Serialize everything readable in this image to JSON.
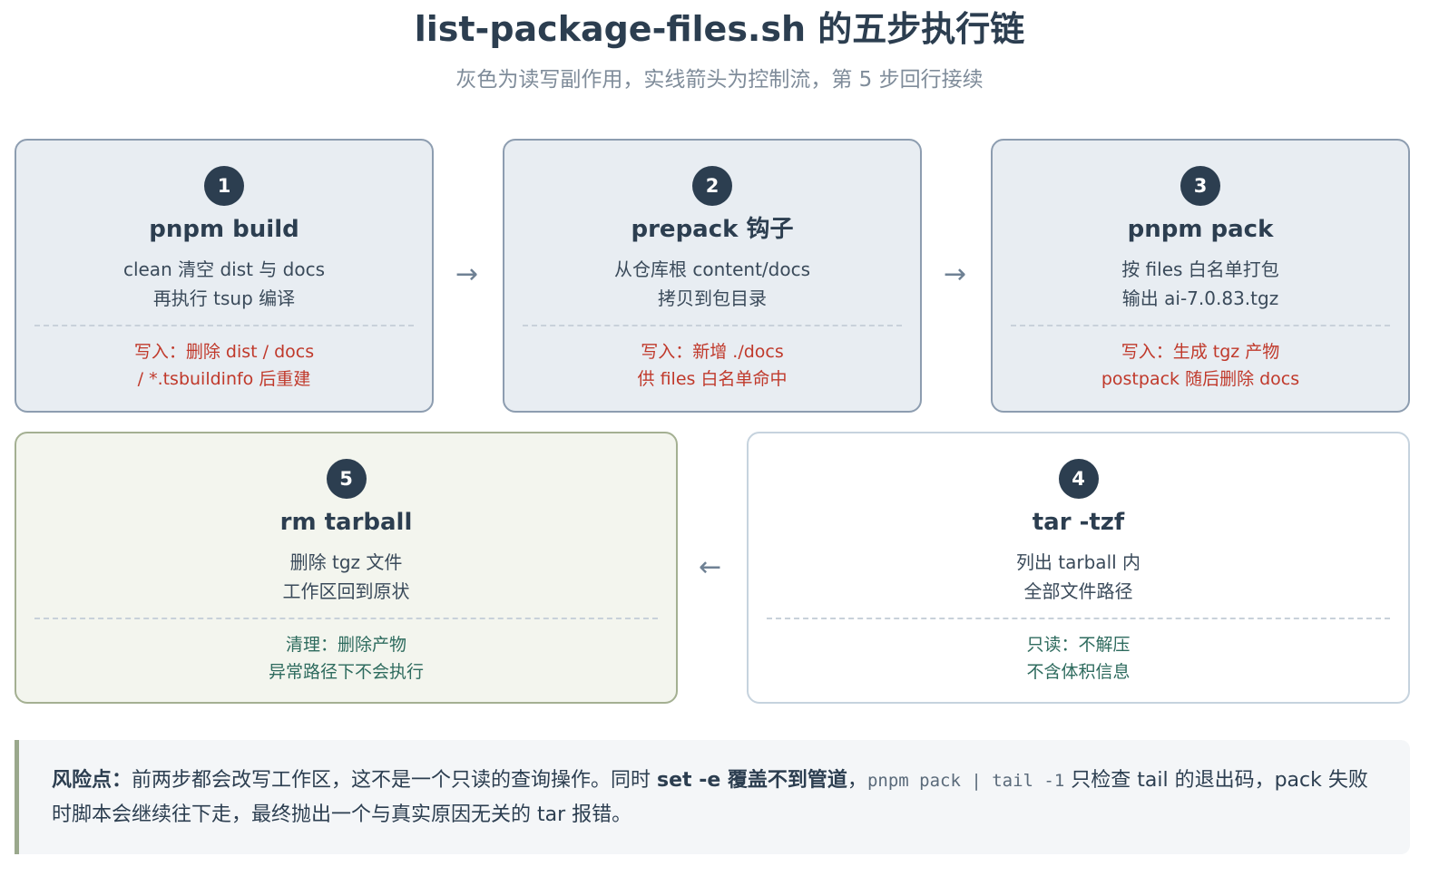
{
  "header": {
    "title": "list-package-files.sh 的五步执行链",
    "subtitle": "灰色为读写副作用，实线箭头为控制流，第 5 步回行接续"
  },
  "steps": [
    {
      "num": "1",
      "title": "pnpm build",
      "desc1": "clean 清空 dist 与 docs",
      "desc2": "再执行 tsup 编译",
      "note1": "写入：删除 dist / docs",
      "note2": "/ *.tsbuildinfo 后重建"
    },
    {
      "num": "2",
      "title": "prepack 钩子",
      "desc1": "从仓库根 content/docs",
      "desc2": "拷贝到包目录",
      "note1": "写入：新增 ./docs",
      "note2": "供 files 白名单命中"
    },
    {
      "num": "3",
      "title": "pnpm pack",
      "desc1": "按 files 白名单打包",
      "desc2": "输出 ai-7.0.83.tgz",
      "note1": "写入：生成 tgz 产物",
      "note2": "postpack 随后删除 docs"
    },
    {
      "num": "4",
      "title": "tar -tzf",
      "desc1": "列出 tarball 内",
      "desc2": "全部文件路径",
      "note1": "只读：不解压",
      "note2": "不含体积信息"
    },
    {
      "num": "5",
      "title": "rm tarball",
      "desc1": "删除 tgz 文件",
      "desc2": "工作区回到原状",
      "note1": "清理：删除产物",
      "note2": "异常路径下不会执行"
    }
  ],
  "arrows": {
    "right": "→",
    "left": "←"
  },
  "risk": {
    "label": "风险点：",
    "text1": "前两步都会改写工作区，这不是一个只读的查询操作。同时 ",
    "bold1": "set -e 覆盖不到管道",
    "text2": "，",
    "code": "pnpm pack | tail -1",
    "text3": " 只检查 tail 的退出码，pack 失败时脚本会继续往下走，最终抛出一个与真实原因无关的 tar 报错。"
  }
}
